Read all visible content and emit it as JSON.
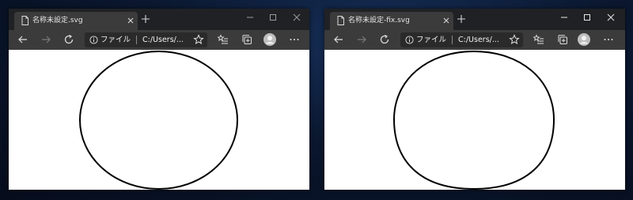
{
  "windows": [
    {
      "tab_title": "名称未設定.svg",
      "address_protocol": "ファイル",
      "address_path": "C:/Users/...",
      "shape": "circle"
    },
    {
      "tab_title": "名称未設定-fix.svg",
      "address_protocol": "ファイル",
      "address_path": "C:/Users/...",
      "shape": "rounded-circle"
    }
  ],
  "icons": {
    "page": "page-icon",
    "close_tab": "close-icon",
    "new_tab": "plus-icon",
    "minimize": "minimize-icon",
    "maximize": "maximize-icon",
    "close_window": "close-window-icon",
    "back": "back-arrow-icon",
    "forward": "forward-arrow-icon",
    "refresh": "refresh-icon",
    "info": "info-icon",
    "favorite": "star-icon",
    "favorites_list": "favorites-list-icon",
    "collections": "collections-icon",
    "profile": "avatar",
    "more": "more-icon"
  },
  "colors": {
    "tabbar": "#202124",
    "active_tab": "#3b3b3b",
    "toolbar": "#3b3b3b",
    "address_bar": "#2a2a2a",
    "page": "#ffffff",
    "stroke": "#000000"
  }
}
